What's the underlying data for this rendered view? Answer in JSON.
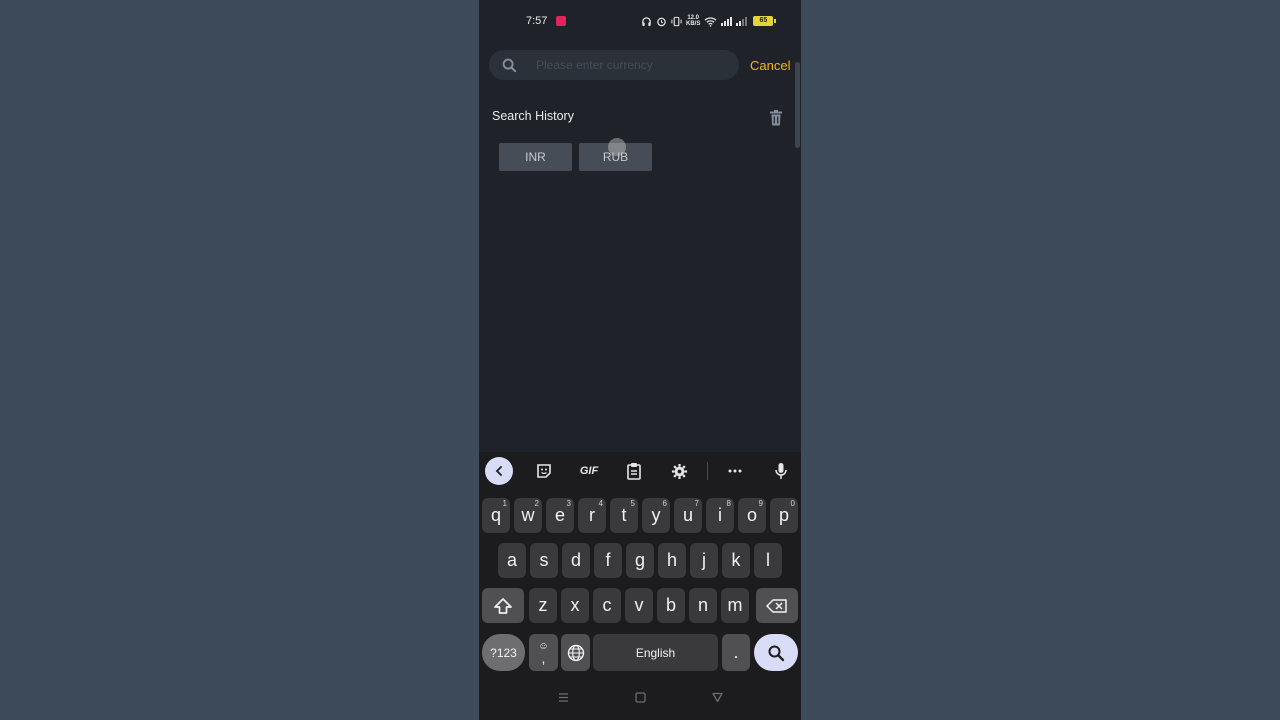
{
  "status_bar": {
    "time": "7:57",
    "net_speed_value": "12.0",
    "net_speed_unit": "KB/S",
    "battery": "65"
  },
  "search": {
    "placeholder": "Please enter currency",
    "value": "",
    "cancel_label": "Cancel"
  },
  "history": {
    "title": "Search History",
    "items": [
      "INR",
      "RUB"
    ]
  },
  "keyboard": {
    "toolbar": {
      "gif_label": "GIF"
    },
    "row1": [
      {
        "k": "q",
        "h": "1"
      },
      {
        "k": "w",
        "h": "2"
      },
      {
        "k": "e",
        "h": "3"
      },
      {
        "k": "r",
        "h": "4"
      },
      {
        "k": "t",
        "h": "5"
      },
      {
        "k": "y",
        "h": "6"
      },
      {
        "k": "u",
        "h": "7"
      },
      {
        "k": "i",
        "h": "8"
      },
      {
        "k": "o",
        "h": "9"
      },
      {
        "k": "p",
        "h": "0"
      }
    ],
    "row2": [
      "a",
      "s",
      "d",
      "f",
      "g",
      "h",
      "j",
      "k",
      "l"
    ],
    "row3": [
      "z",
      "x",
      "c",
      "v",
      "b",
      "n",
      "m"
    ],
    "numbers_label": "?123",
    "emoji_label": "☺",
    "comma_label": ",",
    "space_label": "English",
    "period_label": "."
  },
  "colors": {
    "accent": "#f0b90b",
    "background": "#1f2329",
    "chip": "#474d57"
  }
}
